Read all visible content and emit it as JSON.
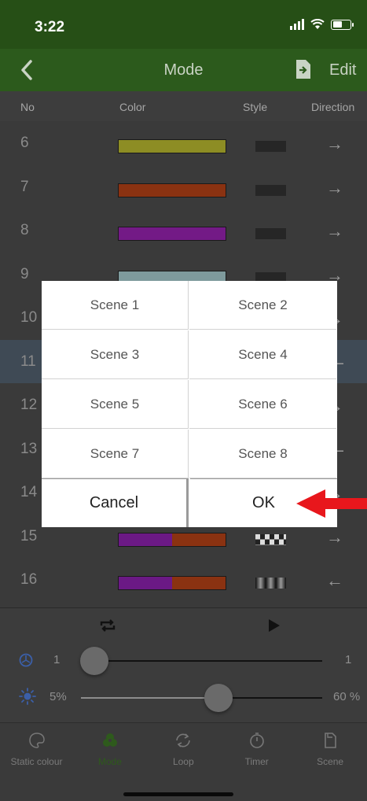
{
  "status_bar": {
    "time": "3:22"
  },
  "nav": {
    "title": "Mode",
    "edit_label": "Edit"
  },
  "columns": {
    "no": "No",
    "color": "Color",
    "style": "Style",
    "direction": "Direction"
  },
  "rows": [
    {
      "no": "6",
      "colors": [
        "#8d8d24"
      ],
      "style": "solid",
      "direction": "→"
    },
    {
      "no": "7",
      "colors": [
        "#8a3211"
      ],
      "style": "solid",
      "direction": "→"
    },
    {
      "no": "8",
      "colors": [
        "#731a86"
      ],
      "style": "solid",
      "direction": "→"
    },
    {
      "no": "9",
      "colors": [
        "#7e9a9c"
      ],
      "style": "solid",
      "direction": "→"
    },
    {
      "no": "10",
      "colors": [
        "#555555"
      ],
      "style": "solid",
      "direction": "→"
    },
    {
      "no": "11",
      "colors": [
        "#555555"
      ],
      "style": "solid",
      "direction": "—"
    },
    {
      "no": "12",
      "colors": [
        "#555555"
      ],
      "style": "solid",
      "direction": "→"
    },
    {
      "no": "13",
      "colors": [
        "#555555"
      ],
      "style": "solid",
      "direction": "—"
    },
    {
      "no": "14",
      "colors": [
        "#555555"
      ],
      "style": "solid",
      "direction": "→"
    },
    {
      "no": "15",
      "colors": [
        "#6b1985",
        "#8a3211"
      ],
      "style": "check",
      "direction": "→"
    },
    {
      "no": "16",
      "colors": [
        "#6b1985",
        "#8a3211"
      ],
      "style": "gradient",
      "direction": "←"
    }
  ],
  "selected_row": "11",
  "controls": {
    "speed_min": "1",
    "speed_max": "1",
    "speed_value": 0.0,
    "brightness_min": "5%",
    "brightness_max": "60 %",
    "brightness_value": 0.57
  },
  "tabs": [
    {
      "label": "Static colour",
      "icon": "palette-icon",
      "active": false
    },
    {
      "label": "Mode",
      "icon": "mode-icon",
      "active": true
    },
    {
      "label": "Loop",
      "icon": "loop-icon",
      "active": false
    },
    {
      "label": "Timer",
      "icon": "timer-icon",
      "active": false
    },
    {
      "label": "Scene",
      "icon": "scene-icon",
      "active": false
    }
  ],
  "dialog": {
    "scenes": [
      "Scene 1",
      "Scene 2",
      "Scene 3",
      "Scene 4",
      "Scene 5",
      "Scene 6",
      "Scene 7",
      "Scene 8"
    ],
    "cancel_label": "Cancel",
    "ok_label": "OK"
  },
  "colors": {
    "nav_green": "#2c5a1c",
    "active_tab": "#2e5a1c",
    "arrow_red": "#e8171c"
  }
}
